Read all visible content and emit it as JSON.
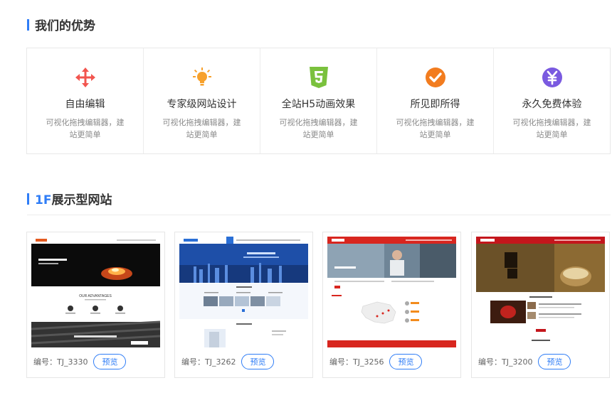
{
  "advantages": {
    "title": "我们的优势",
    "items": [
      {
        "title": "自由编辑",
        "desc": "可视化拖拽编辑器，建站更简单",
        "icon": "move-arrows-icon",
        "color": "#f2554f"
      },
      {
        "title": "专家级网站设计",
        "desc": "可视化拖拽编辑器，建站更简单",
        "icon": "lightbulb-icon",
        "color": "#f7a12c"
      },
      {
        "title": "全站H5动画效果",
        "desc": "可视化拖拽编辑器，建站更简单",
        "icon": "html5-icon",
        "color": "#7ac13d"
      },
      {
        "title": "所见即所得",
        "desc": "可视化拖拽编辑器，建站更简单",
        "icon": "check-circle-icon",
        "color": "#f27c1f"
      },
      {
        "title": "永久免费体验",
        "desc": "可视化拖拽编辑器，建站更简单",
        "icon": "yen-circle-icon",
        "color": "#7a5ae0"
      }
    ]
  },
  "showcase": {
    "title_prefix": "1F",
    "title_rest": "展示型网站",
    "preview_label": "预览",
    "templates": [
      {
        "code": "编号：TJ_3330",
        "thumb_banner": "我们会把梦想...",
        "thumb_section": "OUR ADVANTAGES"
      },
      {
        "code": "编号：TJ_3262",
        "thumb_banner": "",
        "thumb_section": "推荐产品"
      },
      {
        "code": "编号：TJ_3256",
        "thumb_banner": "",
        "thumb_section": "服务网络"
      },
      {
        "code": "编号：TJ_3200",
        "thumb_banner": "",
        "thumb_section": "新闻资讯"
      }
    ]
  },
  "accent": "#2f7df6"
}
